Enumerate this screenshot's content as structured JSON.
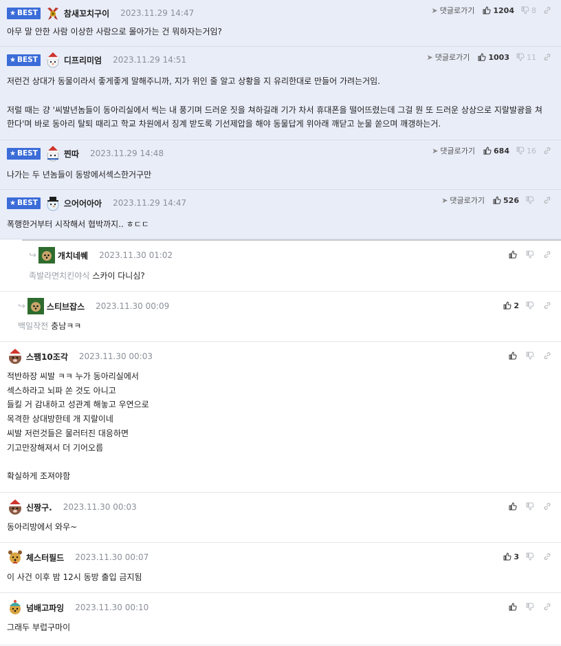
{
  "best_label": "BEST",
  "goto_label": "댓글로가기",
  "comments": [
    {
      "nick": "참새꼬치구이",
      "time": "2023.11.29 14:47",
      "up": "1204",
      "down": "8",
      "lines": [
        "아무 말 안한 사람 이상한 사람으로 몰아가는 건 뭐하자는거임?"
      ]
    },
    {
      "nick": "디프리미엄",
      "time": "2023.11.29 14:51",
      "up": "1003",
      "down": "11",
      "lines": [
        "저런건 상대가 동물이라서 좋게좋게 말해주니까, 지가 위인 줄 알고 상황을 지 유리한대로 만들어 가려는거임.",
        "",
        "저럴 때는 걍 '씨발년놈들이 동아리실에서 씩는 내 풍기며 드러운 짓을 쳐하길래 기가 차서 휴대폰을 떨어뜨렸는데 그걸 뭔 또 드러운 상상으로 지랄발광을 쳐",
        "한다'며 바로 동아리 탈퇴 때리고 학교 차원에서 징계 받도록 기선제압을 해야 동물답게 위아래 깨닫고 눈물 쏟으며 깨갱하는거."
      ]
    },
    {
      "nick": "찐따",
      "time": "2023.11.29 14:48",
      "up": "684",
      "down": "16",
      "lines": [
        "나가는 두 년놈들이 동방에서섹스한거구만"
      ]
    },
    {
      "nick": "으어어아아",
      "time": "2023.11.29 14:47",
      "up": "526",
      "down": "",
      "lines": [
        "폭행한거부터 시작해서 협박까지.. ㅎㄷㄷ"
      ]
    },
    {
      "nick": "개치네쒜",
      "time": "2023.11.30 01:02",
      "up": "",
      "down": "",
      "mention": "족발라면치킨야식",
      "lines": [
        "스카이 다니심?"
      ]
    },
    {
      "nick": "스티브잡스",
      "time": "2023.11.30 00:09",
      "up": "2",
      "down": "",
      "mention": "백일작전",
      "lines": [
        "충남ㅋㅋ"
      ]
    },
    {
      "nick": "스팸10조각",
      "time": "2023.11.30 00:03",
      "up": "",
      "down": "",
      "lines": [
        "적반하장 씨발 ㅋㅋ 누가 동아리실에서",
        "섹스하라고 뇌파 쏜 것도 아니고",
        "들킬 거 감내하고 성관계 해놓고 우연으로",
        "목격한 상대방한테 개 지랄이네",
        "씨발 저런것들은 물러터진 대응하면",
        "기고만장해져서 더 기어오름",
        "",
        "확실하게 조져야함"
      ]
    },
    {
      "nick": "신짱구.",
      "time": "2023.11.30 00:03",
      "up": "",
      "down": "",
      "lines": [
        "동아리방에서 와우~"
      ]
    },
    {
      "nick": "체스터필드",
      "time": "2023.11.30 00:07",
      "up": "3",
      "down": "",
      "lines": [
        "이 사건 이후 밤 12시 동방 출입 금지됨"
      ]
    },
    {
      "nick": "넘배고파잉",
      "time": "2023.11.30 00:10",
      "up": "",
      "down": "",
      "lines": [
        "그래두 부럽구마이"
      ]
    }
  ]
}
